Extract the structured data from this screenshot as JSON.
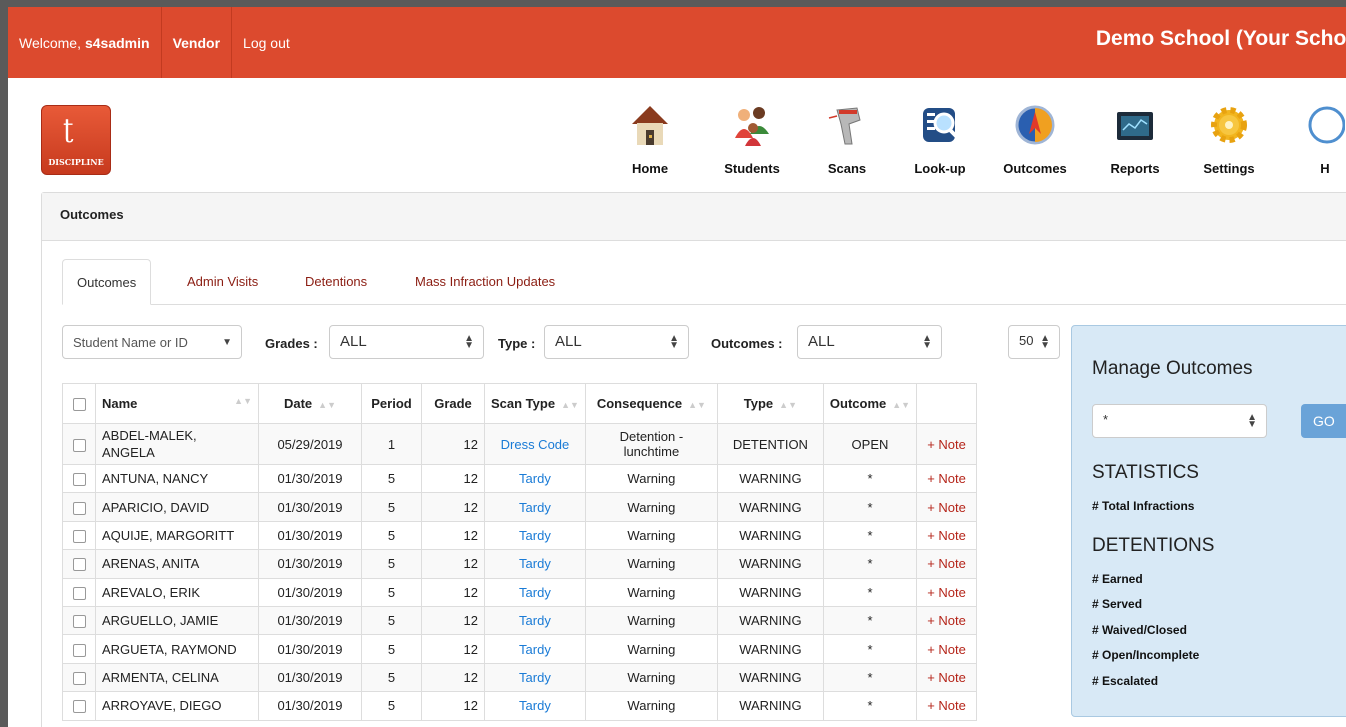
{
  "topbar": {
    "welcome": "Welcome,",
    "user": "s4sadmin",
    "vendor": "Vendor",
    "logout": "Log out",
    "school": "Demo School (Your School N"
  },
  "logo": {
    "text": "DISCIPLINE"
  },
  "nav": [
    {
      "label": "Home",
      "icon": "house-icon"
    },
    {
      "label": "Students",
      "icon": "students-icon"
    },
    {
      "label": "Scans",
      "icon": "barcode-scanner-icon"
    },
    {
      "label": "Look-up",
      "icon": "magnifier-icon"
    },
    {
      "label": "Outcomes",
      "icon": "compass-icon"
    },
    {
      "label": "Reports",
      "icon": "monitor-icon"
    },
    {
      "label": "Settings",
      "icon": "gear-icon"
    },
    {
      "label": "H",
      "icon": "help-icon"
    }
  ],
  "panel": {
    "title": "Outcomes"
  },
  "tabs": [
    "Outcomes",
    "Admin Visits",
    "Detentions",
    "Mass Infraction Updates"
  ],
  "filters": {
    "student_placeholder": "Student Name or ID",
    "grades_label": "Grades :",
    "grades_value": "ALL",
    "type_label": "Type :",
    "type_value": "ALL",
    "outcomes_label": "Outcomes :",
    "outcomes_value": "ALL",
    "page_size": "50"
  },
  "table": {
    "headers": [
      "Name",
      "Date",
      "Period",
      "Grade",
      "Scan Type",
      "Consequence",
      "Type",
      "Outcome"
    ],
    "rows": [
      {
        "name": "ABDEL-MALEK, ANGELA",
        "date": "05/29/2019",
        "period": "1",
        "grade": "12",
        "scan": "Dress Code",
        "consequence": "Detention - lunchtime",
        "type": "DETENTION",
        "outcome": "OPEN",
        "note": "+ Note"
      },
      {
        "name": "ANTUNA, NANCY",
        "date": "01/30/2019",
        "period": "5",
        "grade": "12",
        "scan": "Tardy",
        "consequence": "Warning",
        "type": "WARNING",
        "outcome": "*",
        "note": "+ Note"
      },
      {
        "name": "APARICIO, DAVID",
        "date": "01/30/2019",
        "period": "5",
        "grade": "12",
        "scan": "Tardy",
        "consequence": "Warning",
        "type": "WARNING",
        "outcome": "*",
        "note": "+ Note"
      },
      {
        "name": "AQUIJE, MARGORITT",
        "date": "01/30/2019",
        "period": "5",
        "grade": "12",
        "scan": "Tardy",
        "consequence": "Warning",
        "type": "WARNING",
        "outcome": "*",
        "note": "+ Note"
      },
      {
        "name": "ARENAS, ANITA",
        "date": "01/30/2019",
        "period": "5",
        "grade": "12",
        "scan": "Tardy",
        "consequence": "Warning",
        "type": "WARNING",
        "outcome": "*",
        "note": "+ Note"
      },
      {
        "name": "AREVALO, ERIK",
        "date": "01/30/2019",
        "period": "5",
        "grade": "12",
        "scan": "Tardy",
        "consequence": "Warning",
        "type": "WARNING",
        "outcome": "*",
        "note": "+ Note"
      },
      {
        "name": "ARGUELLO, JAMIE",
        "date": "01/30/2019",
        "period": "5",
        "grade": "12",
        "scan": "Tardy",
        "consequence": "Warning",
        "type": "WARNING",
        "outcome": "*",
        "note": "+ Note"
      },
      {
        "name": "ARGUETA, RAYMOND",
        "date": "01/30/2019",
        "period": "5",
        "grade": "12",
        "scan": "Tardy",
        "consequence": "Warning",
        "type": "WARNING",
        "outcome": "*",
        "note": "+ Note"
      },
      {
        "name": "ARMENTA, CELINA",
        "date": "01/30/2019",
        "period": "5",
        "grade": "12",
        "scan": "Tardy",
        "consequence": "Warning",
        "type": "WARNING",
        "outcome": "*",
        "note": "+ Note"
      },
      {
        "name": "ARROYAVE, DIEGO",
        "date": "01/30/2019",
        "period": "5",
        "grade": "12",
        "scan": "Tardy",
        "consequence": "Warning",
        "type": "WARNING",
        "outcome": "*",
        "note": "+ Note"
      }
    ]
  },
  "manage": {
    "title": "Manage Outcomes",
    "select_value": "*",
    "go": "GO",
    "statistics": "STATISTICS",
    "total": "# Total Infractions",
    "detentions": "DETENTIONS",
    "earned": "# Earned",
    "served": "# Served",
    "waived": "# Waived/Closed",
    "open": "# Open/Incomplete",
    "escalated": "# Escalated"
  },
  "colors": {
    "brand": "#dc4a2e",
    "link": "#1a7bd6",
    "note": "#b5251a",
    "panel": "#d8e9f6"
  }
}
